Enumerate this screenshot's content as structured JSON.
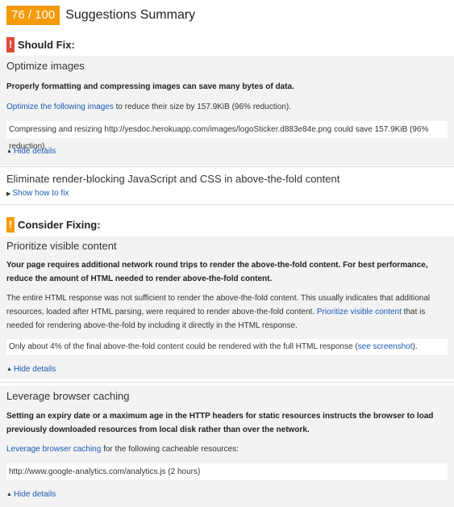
{
  "header": {
    "score": "76 / 100",
    "title": "Suggestions Summary"
  },
  "should_fix": {
    "icon": "!",
    "label": "Should Fix:",
    "rules": [
      {
        "title": "Optimize images",
        "summary": "Properly formatting and compressing images can save many bytes of data.",
        "link": "Optimize the following images",
        "detail_rest": " to reduce their size by 157.9KiB (96% reduction).",
        "url_item": "Compressing and resizing http://yesdoc.herokuapp.com/images/logoSticker.d883e84e.png could save 157.9KiB (96% reduction).",
        "toggle": "Hide details"
      },
      {
        "title": "Eliminate render-blocking JavaScript and CSS in above-the-fold content",
        "toggle": "Show how to fix"
      }
    ]
  },
  "consider": {
    "icon": "!",
    "label": "Consider Fixing:",
    "rules": [
      {
        "title": "Prioritize visible content",
        "summary": "Your page requires additional network round trips to render the above-the-fold content. For best performance, reduce the amount of HTML needed to render above-the-fold content.",
        "body_pre": "The entire HTML response was not sufficient to render the above-the-fold content. This usually indicates that additional resources, loaded after HTML parsing, were required to render above-the-fold content. ",
        "link": "Prioritize visible content",
        "body_post": " that is needed for rendering above-the-fold by including it directly in the HTML response.",
        "url_pre": "Only about 4% of the final above-the-fold content could be rendered with the full HTML response (",
        "url_link": "see screenshot",
        "url_post": ").",
        "toggle": "Hide details"
      },
      {
        "title": "Leverage browser caching",
        "summary": "Setting an expiry date or a maximum age in the HTTP headers for static resources instructs the browser to load previously downloaded resources from local disk rather than over the network.",
        "link": "Leverage browser caching",
        "detail_rest": " for the following cacheable resources:",
        "url_item": "http://www.google-analytics.com/analytics.js (2 hours)",
        "toggle": "Hide details"
      }
    ]
  }
}
